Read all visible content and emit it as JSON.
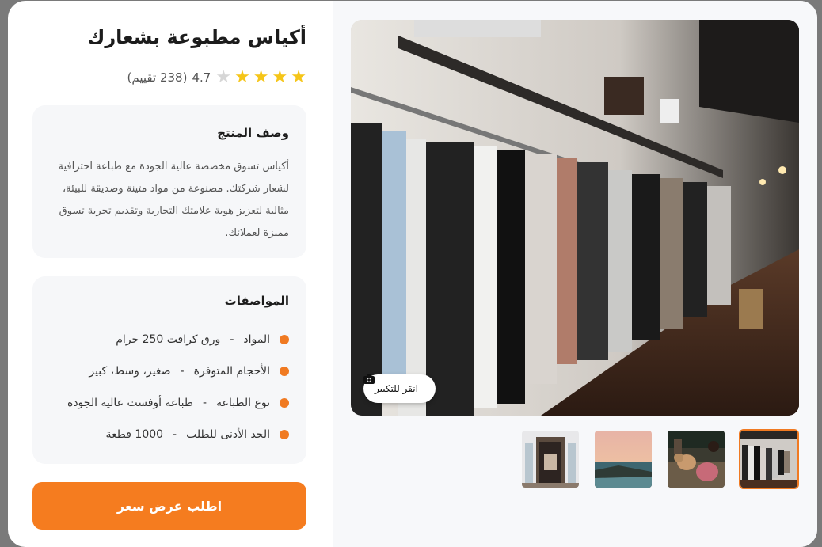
{
  "product": {
    "title": "أكياس مطبوعة بشعارك",
    "rating_value": "4.7",
    "rating_count": "(238 تقييم)",
    "rating_stars": 4
  },
  "description": {
    "heading": "وصف المنتج",
    "text": "أكياس تسوق مخصصة عالية الجودة مع طباعة احترافية لشعار شركتك. مصنوعة من مواد متينة وصديقة للبيئة، مثالية لتعزيز هوية علامتك التجارية وتقديم تجربة تسوق مميزة لعملائك."
  },
  "specs": {
    "heading": "المواصفات",
    "items": [
      {
        "label": "المواد",
        "sep": "-",
        "value": "ورق كرافت 250 جرام"
      },
      {
        "label": "الأحجام المتوفرة",
        "sep": "-",
        "value": "صغير، وسط، كبير"
      },
      {
        "label": "نوع الطباعة",
        "sep": "-",
        "value": "طباعة أوفست عالية الجودة"
      },
      {
        "label": "الحد الأدنى للطلب",
        "sep": "-",
        "value": "1000 قطعة"
      }
    ]
  },
  "cta": {
    "label": "اطلب عرض سعر"
  },
  "gallery": {
    "zoom_label": "انقر للتكبير",
    "zoom_icon": "camera-icon",
    "active_index": 0,
    "thumbnails": [
      "clothing-rack",
      "people-with-dog",
      "sunset-coast",
      "doorway-interior"
    ]
  },
  "colors": {
    "accent": "#f57c1f",
    "star": "#f5c518"
  }
}
